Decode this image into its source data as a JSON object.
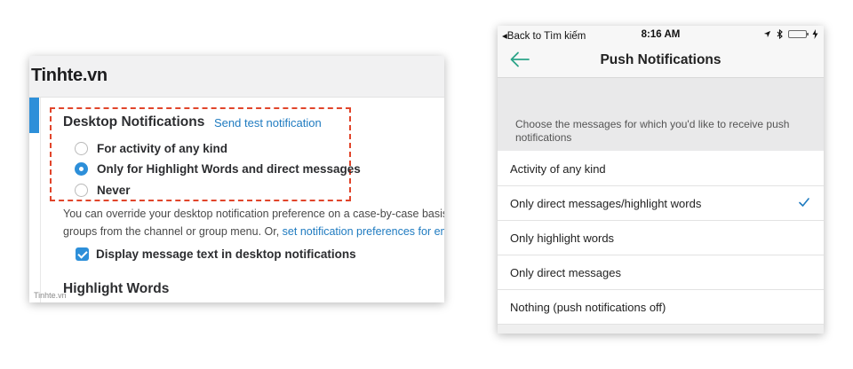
{
  "desktop": {
    "brand": "Tinhte.vn",
    "section_title": "Desktop Notifications",
    "send_test_label": "Send test notification",
    "options": [
      {
        "label": "For activity of any kind",
        "checked": false
      },
      {
        "label": "Only for Highlight Words and direct messages",
        "checked": true
      },
      {
        "label": "Never",
        "checked": false
      }
    ],
    "override_line1": "You can override your desktop notification preference on a case-by-case basis f",
    "override_line2": "groups from the channel or group menu. Or, ",
    "override_link": "set notification preferences for em",
    "checkbox_label": "Display message text in desktop notifications",
    "checkbox_checked": true,
    "highlight_title": "Highlight Words",
    "watermark": "Tinhte.vn",
    "accent_color": "#2d8fd9",
    "dashed_color": "#e1452b"
  },
  "mobile": {
    "status": {
      "back_label": "◂Back to Tìm kiếm",
      "time": "8:16 AM"
    },
    "nav_title": "Push Notifications",
    "description": "Choose the messages for which you'd like to receive push notifications",
    "options": [
      {
        "label": "Activity of any kind",
        "selected": false
      },
      {
        "label": "Only direct messages/highlight words",
        "selected": true
      },
      {
        "label": "Only highlight words",
        "selected": false
      },
      {
        "label": "Only direct messages",
        "selected": false
      },
      {
        "label": "Nothing (push notifications off)",
        "selected": false
      }
    ],
    "accent_color": "#2ca488"
  }
}
